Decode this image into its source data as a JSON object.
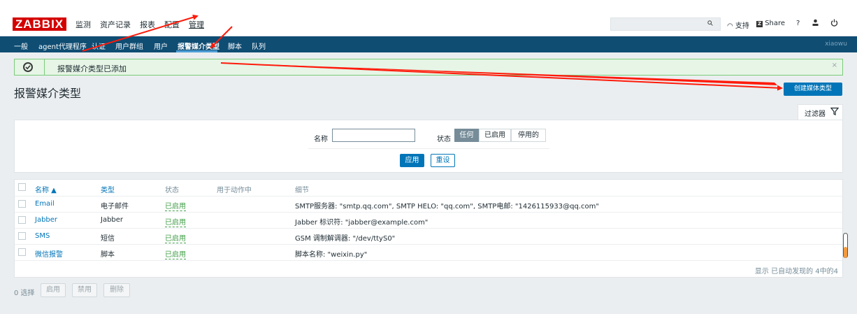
{
  "header": {
    "logo": "ZABBIX",
    "menu": [
      "监测",
      "资产记录",
      "报表",
      "配置",
      "管理"
    ],
    "support": "支持",
    "share": "Share",
    "help": "?"
  },
  "nav": {
    "items": [
      "一般",
      "agent代理程序",
      "认证",
      "用户群组",
      "用户",
      "报警媒介类型",
      "脚本",
      "队列"
    ],
    "active": "报警媒介类型",
    "user": "xiaowu"
  },
  "message": {
    "text": "报警媒介类型已添加",
    "close": "×"
  },
  "page": {
    "title": "报警媒介类型",
    "create_button": "创建媒体类型"
  },
  "filter": {
    "tab_label": "过滤器",
    "name_label": "名称",
    "name_value": "",
    "status_label": "状态",
    "status_options": [
      "任何",
      "已启用",
      "停用的"
    ],
    "status_selected": "任何",
    "apply": "应用",
    "reset": "重设"
  },
  "table": {
    "columns": [
      "名称 ▲",
      "类型",
      "状态",
      "用于动作中",
      "细节"
    ],
    "rows": [
      {
        "name": "Email",
        "type": "电子邮件",
        "status": "已启用",
        "used": "",
        "details": "SMTP服务器: \"smtp.qq.com\", SMTP HELO: \"qq.com\", SMTP电邮: \"1426115933@qq.com\""
      },
      {
        "name": "Jabber",
        "type": "Jabber",
        "status": "已启用",
        "used": "",
        "details": "Jabber 标识符: \"jabber@example.com\""
      },
      {
        "name": "SMS",
        "type": "短信",
        "status": "已启用",
        "used": "",
        "details": "GSM 调制解调器: \"/dev/ttyS0\""
      },
      {
        "name": "微信报警",
        "type": "脚本",
        "status": "已启用",
        "used": "",
        "details": "脚本名称: \"weixin.py\""
      }
    ],
    "footer": "显示 已自动发现的 4中的4"
  },
  "bulk": {
    "selected": "0 选择",
    "buttons": [
      "启用",
      "禁用",
      "删除"
    ]
  },
  "colors": {
    "logo": "#d40000",
    "nav": "#0f4d73",
    "accent": "#0275b8",
    "enabled": "#429e47",
    "annotation_arrow": "#ff1a0a"
  }
}
